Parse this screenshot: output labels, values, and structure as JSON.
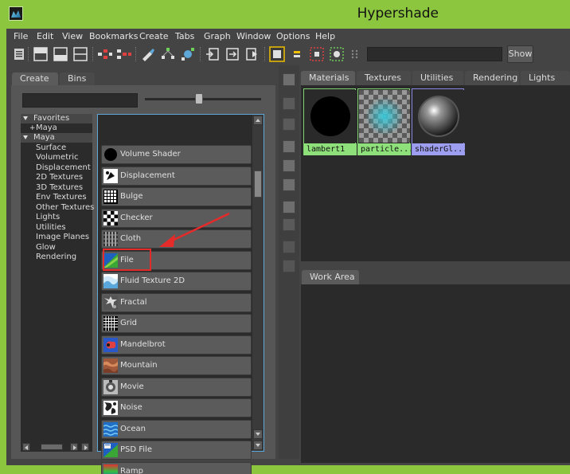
{
  "window": {
    "title": "Hypershade"
  },
  "menubar": {
    "items": [
      "File",
      "Edit",
      "View",
      "Bookmarks",
      "Create",
      "Tabs",
      "Graph",
      "Window",
      "Options",
      "Help"
    ]
  },
  "toolbar": {
    "icons": [
      "list-icon",
      "layout-top-icon",
      "layout-bottom-icon",
      "layout-split-icon",
      "graph-input-icon",
      "graph-output-icon",
      "brush-icon",
      "network-icon",
      "network-expand-icon",
      "import-icon",
      "export-icon",
      "render-icon",
      "swatch-icon",
      "swatch-small-icon",
      "snapshot-icon",
      "frame-icon",
      "dots-icon"
    ],
    "search_value": "",
    "show_label": "Show"
  },
  "left_panel": {
    "tabs": [
      "Create",
      "Bins"
    ],
    "active_tab": "Create",
    "filter_value": "",
    "icon_size_percent": 46,
    "tree": [
      {
        "label": "Favorites",
        "type": "header"
      },
      {
        "label": "Maya",
        "type": "collapsed"
      },
      {
        "label": "Maya",
        "type": "header"
      },
      {
        "label": "Surface",
        "type": "item"
      },
      {
        "label": "Volumetric",
        "type": "item"
      },
      {
        "label": "Displacement",
        "type": "item"
      },
      {
        "label": "2D Textures",
        "type": "item"
      },
      {
        "label": "3D Textures",
        "type": "item"
      },
      {
        "label": "Env Textures",
        "type": "item"
      },
      {
        "label": "Other Textures",
        "type": "item"
      },
      {
        "label": "Lights",
        "type": "item"
      },
      {
        "label": "Utilities",
        "type": "item"
      },
      {
        "label": "Image Planes",
        "type": "item"
      },
      {
        "label": "Glow",
        "type": "item"
      },
      {
        "label": "Rendering",
        "type": "item"
      }
    ],
    "nodes": [
      {
        "label": "Volume Shader",
        "icon": "volume-shader-icon"
      },
      {
        "label": "Displacement",
        "icon": "displacement-icon"
      },
      {
        "label": "Bulge",
        "icon": "bulge-icon"
      },
      {
        "label": "Checker",
        "icon": "checker-icon"
      },
      {
        "label": "Cloth",
        "icon": "cloth-icon"
      },
      {
        "label": "File",
        "icon": "file-icon"
      },
      {
        "label": "Fluid Texture 2D",
        "icon": "fluid-texture-icon"
      },
      {
        "label": "Fractal",
        "icon": "fractal-icon"
      },
      {
        "label": "Grid",
        "icon": "grid-icon"
      },
      {
        "label": "Mandelbrot",
        "icon": "mandelbrot-icon"
      },
      {
        "label": "Mountain",
        "icon": "mountain-icon"
      },
      {
        "label": "Movie",
        "icon": "movie-icon"
      },
      {
        "label": "Noise",
        "icon": "noise-icon"
      },
      {
        "label": "Ocean",
        "icon": "ocean-icon"
      },
      {
        "label": "PSD File",
        "icon": "psd-file-icon"
      },
      {
        "label": "Ramp",
        "icon": "ramp-icon"
      }
    ],
    "highlighted_node": "File"
  },
  "right_panel": {
    "tabs": [
      "Materials",
      "Textures",
      "Utilities",
      "Rendering",
      "Lights"
    ],
    "active_tab": "Materials",
    "swatches": [
      {
        "label": "lambert1",
        "style": "green"
      },
      {
        "label": "particle...",
        "style": "green"
      },
      {
        "label": "shaderGl...",
        "style": "blue"
      }
    ],
    "work_area_tab": "Work Area"
  },
  "colors": {
    "frame": "#8cc63f",
    "panel": "#444444",
    "highlight": "#e52a2a",
    "list_border": "#5da7d9"
  }
}
